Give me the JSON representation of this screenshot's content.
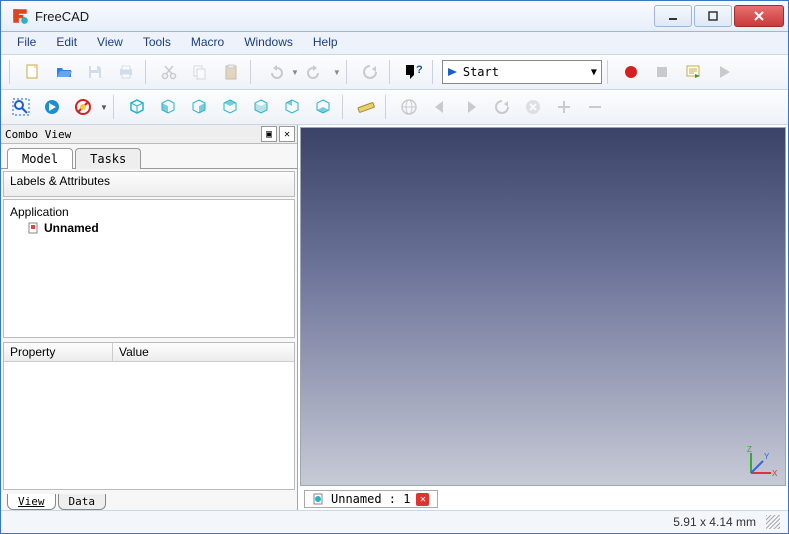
{
  "window": {
    "title": "FreeCAD"
  },
  "menu": {
    "file": "File",
    "edit": "Edit",
    "view": "View",
    "tools": "Tools",
    "macro": "Macro",
    "windows": "Windows",
    "help": "Help"
  },
  "toolbar1": {
    "new": "new-icon",
    "open": "open-icon",
    "save": "save-icon",
    "print": "print-icon",
    "cut": "cut-icon",
    "copy": "copy-icon",
    "paste": "paste-icon",
    "undo": "undo-icon",
    "redo": "redo-icon",
    "refresh": "refresh-icon",
    "whatsthis": "whatsthis-icon",
    "workbench_selected": "Start",
    "record": "record-icon",
    "stop": "stop-icon",
    "macros": "macros-icon",
    "run": "run-icon"
  },
  "toolbar2": {
    "fitall": "fit-all-icon",
    "fitselection": "fit-selection-icon",
    "drawstyle": "draw-style-icon",
    "iso": "isometric-icon",
    "front": "front-icon",
    "right": "right-icon",
    "top": "top-icon",
    "rear": "rear-icon",
    "left": "left-icon",
    "bottom": "bottom-icon",
    "measure": "measure-icon",
    "web": "web-icon",
    "navback": "navback-icon",
    "navfwd": "navfwd-icon",
    "navrefresh": "navrefresh-icon",
    "navstop": "navstop-icon",
    "zoomin": "zoomin-icon",
    "zoomout": "zoomout-icon"
  },
  "panel": {
    "title": "Combo View",
    "tabs": {
      "model": "Model",
      "tasks": "Tasks"
    },
    "labels_header": "Labels & Attributes",
    "tree": {
      "root": "Application",
      "doc": "Unnamed"
    },
    "prop_headers": {
      "property": "Property",
      "value": "Value"
    },
    "bottom_tabs": {
      "view": "View",
      "data": "Data"
    }
  },
  "viewport": {
    "axis_labels": {
      "x": "X",
      "y": "Y",
      "z": "Z"
    },
    "doc_tab": {
      "label": "Unnamed : 1"
    }
  },
  "status": {
    "dimensions": "5.91 x 4.14  mm"
  },
  "colors": {
    "accent": "#3a76c4",
    "close": "#c83a3a",
    "record": "#d42020",
    "cube": "#27b2c8"
  }
}
